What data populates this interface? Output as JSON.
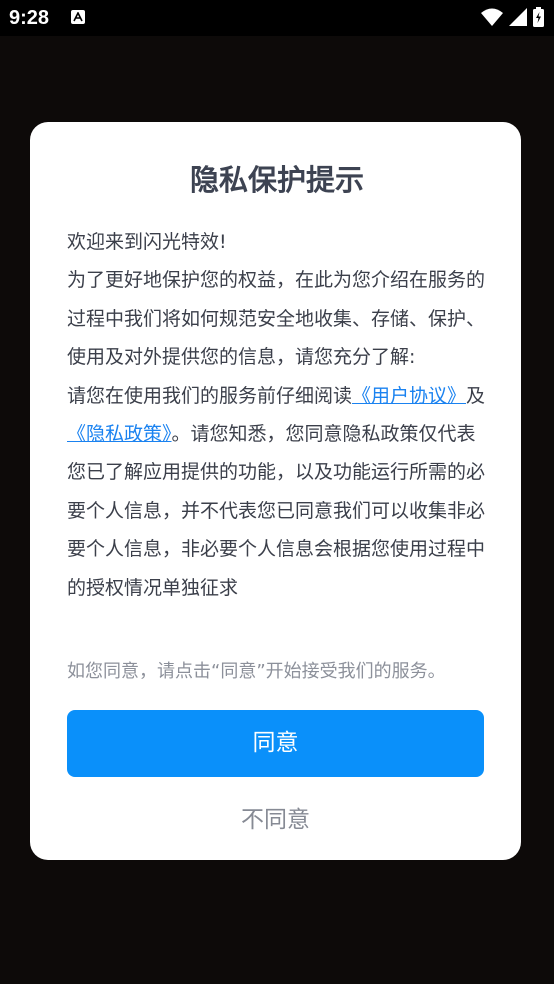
{
  "status_bar": {
    "time": "9:28",
    "icons": [
      "text-a-icon",
      "wifi-icon",
      "signal-icon",
      "battery-charging-icon"
    ]
  },
  "dialog": {
    "title": "隐私保护提示",
    "welcome": "欢迎来到闪光特效!",
    "intro": "为了更好地保护您的权益，在此为您介绍在服务的过程中我们将如何规范安全地收集、存储、保护、使用及对外提供您的信息，请您充分了解:",
    "read_prefix": "请您在使用我们的服务前仔细阅读",
    "user_agreement_link": "《用户协议》",
    "and_text": "及",
    "privacy_policy_link": "《隐私政策》",
    "notice": "。请您知悉，您同意隐私政策仅代表您已了解应用提供的功能，以及功能运行所需的必要个人信息，并不代表您已同意我们可以收集非必要个人信息，非必要个人信息会根据您使用过程中的授权情况单独征求",
    "hint": "如您同意，请点击“同意”开始接受我们的服务。",
    "agree_label": "同意",
    "disagree_label": "不同意"
  },
  "colors": {
    "accent": "#0a90fa",
    "link": "#1a82f0",
    "background": "#0d0a09"
  }
}
